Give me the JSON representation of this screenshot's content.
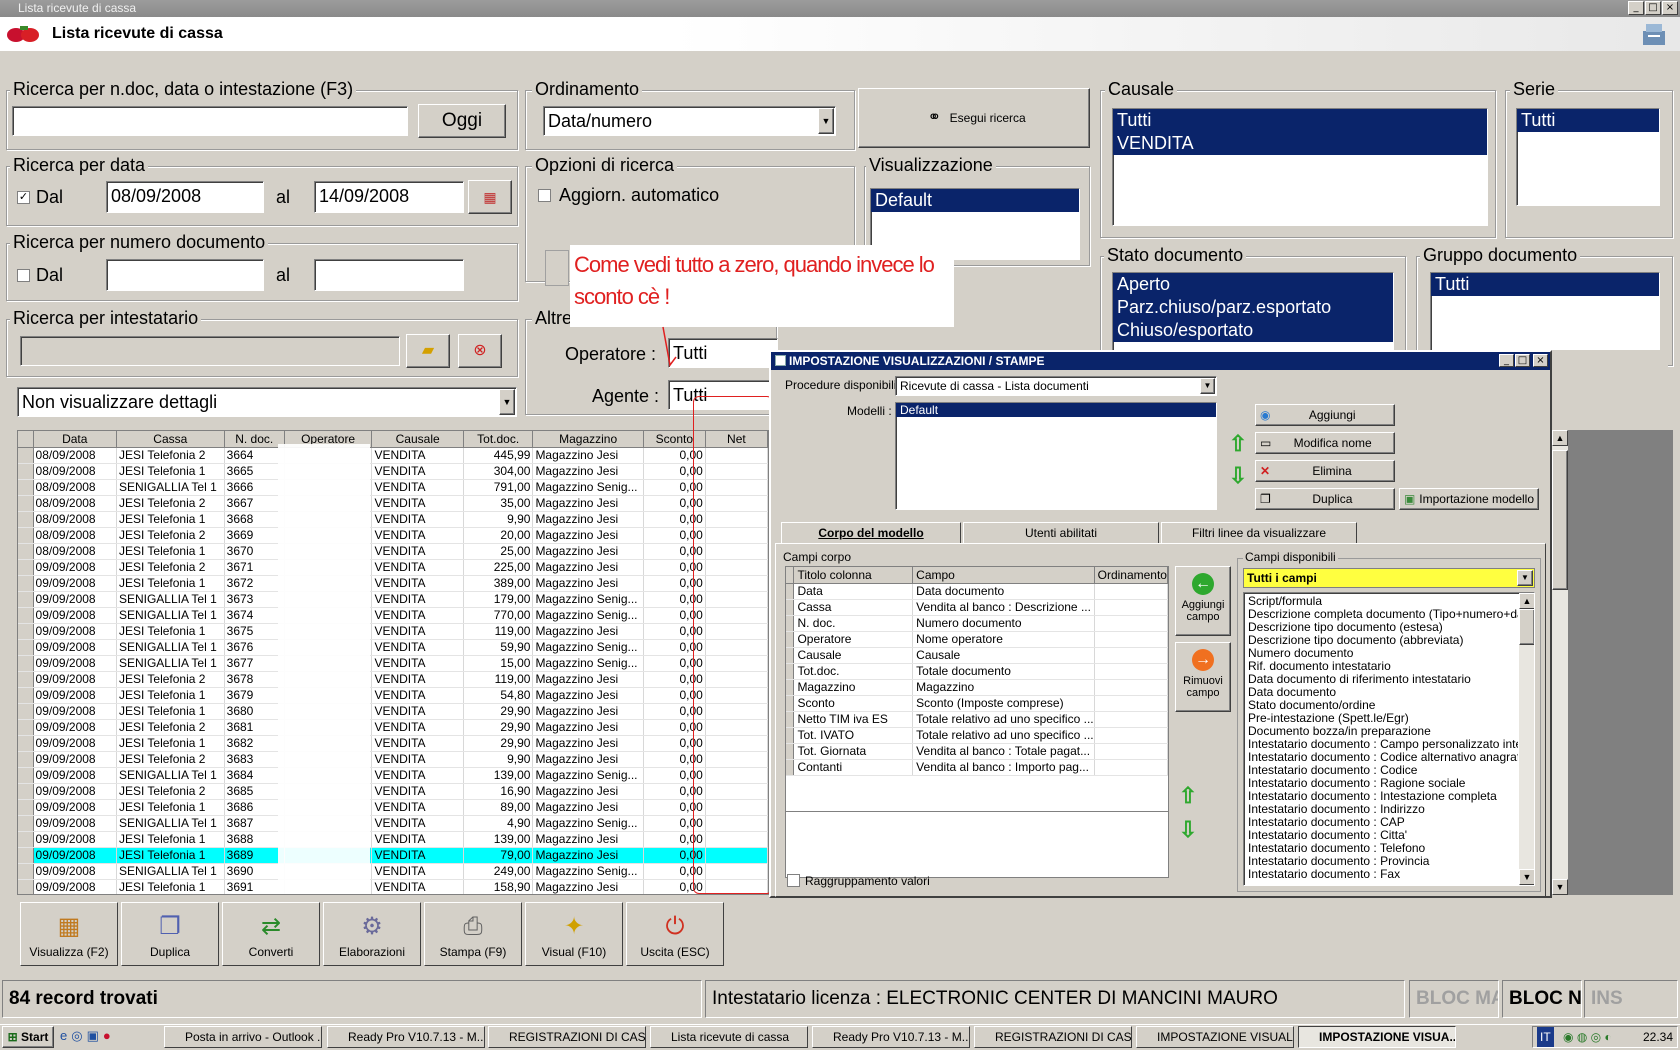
{
  "window": {
    "title": "Lista ricevute di cassa",
    "header_title": "Lista ricevute di cassa"
  },
  "search": {
    "group_label": "Ricerca per n.doc, data o intestazione (F3)",
    "value": "",
    "today_button": "Oggi"
  },
  "ordering": {
    "group_label": "Ordinamento",
    "selected": "Data/numero"
  },
  "execute_button": "Esegui ricerca",
  "causale": {
    "group_label": "Causale",
    "items": [
      "Tutti",
      "VENDITA"
    ]
  },
  "serie": {
    "group_label": "Serie",
    "items": [
      "Tutti"
    ]
  },
  "date_search": {
    "group_label": "Ricerca per data",
    "from_label": "Dal",
    "from_checked": true,
    "from_value": "08/09/2008",
    "to_label": "al",
    "to_value": "14/09/2008"
  },
  "options": {
    "group_label": "Opzioni di ricerca",
    "auto_update_label": "Aggiorn. automatico"
  },
  "view": {
    "group_label": "Visualizzazione",
    "items": [
      "Default"
    ]
  },
  "doc_number_search": {
    "group_label": "Ricerca per numero documento",
    "from_label": "Dal",
    "to_label": "al",
    "from_value": "",
    "to_value": ""
  },
  "doc_state": {
    "group_label": "Stato documento",
    "items": [
      "Aperto",
      "Parz.chiuso/parz.esportato",
      "Chiuso/esportato"
    ]
  },
  "doc_group": {
    "group_label": "Gruppo documento",
    "items": [
      "Tutti"
    ]
  },
  "holder_search": {
    "group_label": "Ricerca per intestatario",
    "value": ""
  },
  "other": {
    "group_label": "Altre",
    "operator_label": "Operatore :",
    "operator_value": "Tutti",
    "agent_label": "Agente :",
    "agent_value": "Tutti"
  },
  "details_select": "Non visualizzare dettagli",
  "annotation": "Come vedi tutto a zero, quando invece lo sconto cè !",
  "grid": {
    "columns": [
      "Data",
      "Cassa",
      "N. doc.",
      "Operatore",
      "Causale",
      "Tot.doc.",
      "Magazzino",
      "Sconto",
      "Net"
    ],
    "rows": [
      [
        "08/09/2008",
        "JESI Telefonia 2",
        "3664",
        "",
        "VENDITA",
        "445,99",
        "Magazzino Jesi",
        "0,00"
      ],
      [
        "08/09/2008",
        "JESI Telefonia 1",
        "3665",
        "",
        "VENDITA",
        "304,00",
        "Magazzino Jesi",
        "0,00"
      ],
      [
        "08/09/2008",
        "SENIGALLIA Tel 1",
        "3666",
        "",
        "VENDITA",
        "791,00",
        "Magazzino Senig...",
        "0,00"
      ],
      [
        "08/09/2008",
        "JESI Telefonia 2",
        "3667",
        "",
        "VENDITA",
        "35,00",
        "Magazzino Jesi",
        "0,00"
      ],
      [
        "08/09/2008",
        "JESI Telefonia 1",
        "3668",
        "",
        "VENDITA",
        "9,90",
        "Magazzino Jesi",
        "0,00"
      ],
      [
        "08/09/2008",
        "JESI Telefonia 2",
        "3669",
        "",
        "VENDITA",
        "20,00",
        "Magazzino Jesi",
        "0,00"
      ],
      [
        "08/09/2008",
        "JESI Telefonia 1",
        "3670",
        "",
        "VENDITA",
        "25,00",
        "Magazzino Jesi",
        "0,00"
      ],
      [
        "09/09/2008",
        "JESI Telefonia 2",
        "3671",
        "",
        "VENDITA",
        "225,00",
        "Magazzino Jesi",
        "0,00"
      ],
      [
        "09/09/2008",
        "JESI Telefonia 1",
        "3672",
        "",
        "VENDITA",
        "389,00",
        "Magazzino Jesi",
        "0,00"
      ],
      [
        "09/09/2008",
        "SENIGALLIA Tel 1",
        "3673",
        "",
        "VENDITA",
        "179,00",
        "Magazzino Senig...",
        "0,00"
      ],
      [
        "09/09/2008",
        "SENIGALLIA Tel 1",
        "3674",
        "",
        "VENDITA",
        "770,00",
        "Magazzino Senig...",
        "0,00"
      ],
      [
        "09/09/2008",
        "JESI Telefonia 1",
        "3675",
        "",
        "VENDITA",
        "119,00",
        "Magazzino Jesi",
        "0,00"
      ],
      [
        "09/09/2008",
        "SENIGALLIA Tel 1",
        "3676",
        "",
        "VENDITA",
        "59,90",
        "Magazzino Senig...",
        "0,00"
      ],
      [
        "09/09/2008",
        "SENIGALLIA Tel 1",
        "3677",
        "",
        "VENDITA",
        "15,00",
        "Magazzino Senig...",
        "0,00"
      ],
      [
        "09/09/2008",
        "JESI Telefonia 2",
        "3678",
        "",
        "VENDITA",
        "119,00",
        "Magazzino Jesi",
        "0,00"
      ],
      [
        "09/09/2008",
        "JESI Telefonia 1",
        "3679",
        "",
        "VENDITA",
        "54,80",
        "Magazzino Jesi",
        "0,00"
      ],
      [
        "09/09/2008",
        "JESI Telefonia 1",
        "3680",
        "",
        "VENDITA",
        "29,90",
        "Magazzino Jesi",
        "0,00"
      ],
      [
        "09/09/2008",
        "JESI Telefonia 2",
        "3681",
        "",
        "VENDITA",
        "29,90",
        "Magazzino Jesi",
        "0,00"
      ],
      [
        "09/09/2008",
        "JESI Telefonia 1",
        "3682",
        "",
        "VENDITA",
        "29,90",
        "Magazzino Jesi",
        "0,00"
      ],
      [
        "09/09/2008",
        "JESI Telefonia 2",
        "3683",
        "",
        "VENDITA",
        "9,90",
        "Magazzino Jesi",
        "0,00"
      ],
      [
        "09/09/2008",
        "SENIGALLIA Tel 1",
        "3684",
        "",
        "VENDITA",
        "139,00",
        "Magazzino Senig...",
        "0,00"
      ],
      [
        "09/09/2008",
        "JESI Telefonia 2",
        "3685",
        "",
        "VENDITA",
        "16,90",
        "Magazzino Jesi",
        "0,00"
      ],
      [
        "09/09/2008",
        "JESI Telefonia 1",
        "3686",
        "",
        "VENDITA",
        "89,00",
        "Magazzino Jesi",
        "0,00"
      ],
      [
        "09/09/2008",
        "SENIGALLIA Tel 1",
        "3687",
        "",
        "VENDITA",
        "4,90",
        "Magazzino Senig...",
        "0,00"
      ],
      [
        "09/09/2008",
        "JESI Telefonia 1",
        "3688",
        "",
        "VENDITA",
        "139,00",
        "Magazzino Jesi",
        "0,00"
      ],
      [
        "09/09/2008",
        "JESI Telefonia 1",
        "3689",
        "",
        "VENDITA",
        "79,00",
        "Magazzino Jesi",
        "0,00"
      ],
      [
        "09/09/2008",
        "SENIGALLIA Tel 1",
        "3690",
        "",
        "VENDITA",
        "249,00",
        "Magazzino Senig...",
        "0,00"
      ],
      [
        "09/09/2008",
        "JESI Telefonia 1",
        "3691",
        "",
        "VENDITA",
        "158,90",
        "Magazzino Jesi",
        "0,00"
      ]
    ],
    "highlighted_row": 25
  },
  "toolbar": [
    {
      "label": "Visualizza (F2)",
      "icon": "view-icon"
    },
    {
      "label": "Duplica",
      "icon": "duplicate-icon"
    },
    {
      "label": "Converti",
      "icon": "convert-icon"
    },
    {
      "label": "Elaborazioni",
      "icon": "process-icon"
    },
    {
      "label": "Stampa (F9)",
      "icon": "print-icon"
    },
    {
      "label": "Visual (F10)",
      "icon": "wand-icon"
    },
    {
      "label": "Uscita (ESC)",
      "icon": "exit-icon"
    }
  ],
  "status": {
    "records": "84 record trovati",
    "license": "Intestatario licenza : ELECTRONIC CENTER DI MANCINI MAURO",
    "caps": "BLOC MA",
    "num": "BLOC N",
    "ins": "INS"
  },
  "dialog": {
    "title": "IMPOSTAZIONE VISUALIZZAZIONI / STAMPE",
    "procedures_label": "Procedure disponibili :",
    "procedures_value": "Ricevute di cassa - Lista documenti",
    "models_label": "Modelli :",
    "models": [
      "Default"
    ],
    "buttons": {
      "add": "Aggiungi",
      "rename": "Modifica nome",
      "delete": "Elimina",
      "duplicate": "Duplica",
      "import": "Importazione modello"
    },
    "tabs": [
      "Corpo del modello",
      "Utenti abilitati",
      "Filtri linee da visualizzare"
    ],
    "body_fields_label": "Campi corpo",
    "body_columns": [
      "Titolo colonna",
      "Campo",
      "Ordinamento"
    ],
    "body_rows": [
      [
        "Data",
        "Data documento",
        ""
      ],
      [
        "Cassa",
        "Vendita al banco : Descrizione ...",
        ""
      ],
      [
        "N. doc.",
        "Numero documento",
        ""
      ],
      [
        "Operatore",
        "Nome operatore",
        ""
      ],
      [
        "Causale",
        "Causale",
        ""
      ],
      [
        "Tot.doc.",
        "Totale documento",
        ""
      ],
      [
        "Magazzino",
        "Magazzino",
        ""
      ],
      [
        "Sconto",
        "Sconto (Imposte comprese)",
        ""
      ],
      [
        "Netto TIM iva ES",
        "Totale relativo ad uno specifico ...",
        ""
      ],
      [
        "Tot. IVATO",
        "Totale relativo ad uno specifico ...",
        ""
      ],
      [
        "Tot. Giornata",
        "Vendita al banco : Totale pagat...",
        ""
      ],
      [
        "Contanti",
        "Vendita al banco : Importo pag...",
        ""
      ]
    ],
    "add_field": "Aggiungi campo",
    "remove_field": "Rimuovi campo",
    "group_values_label": "Raggruppamento valori",
    "available_label": "Campi disponibili",
    "available_filter": "Tutti i campi",
    "available_fields": [
      "Script/formula",
      "Descrizione completa documento (Tipo+numero+data)",
      "Descrizione tipo documento (estesa)",
      "Descrizione tipo documento (abbreviata)",
      "Numero documento",
      "Rif. documento intestatario",
      "Data documento di riferimento intestatario",
      "Data documento",
      "Stato documento/ordine",
      "Pre-intestazione (Spett.le/Egr)",
      "Documento bozza/in preparazione",
      "Intestatario documento : Campo personalizzato intestatario",
      "Intestatario documento : Codice alternativo anagrafica",
      "Intestatario documento : Codice",
      "Intestatario documento : Ragione sociale",
      "Intestatario documento : Intestazione completa",
      "Intestatario documento : Indirizzo",
      "Intestatario documento : CAP",
      "Intestatario documento : Citta'",
      "Intestatario documento : Telefono",
      "Intestatario documento : Provincia",
      "Intestatario documento : Fax"
    ]
  },
  "taskbar": {
    "start": "Start",
    "tasks": [
      "Posta in arrivo - Outlook ...",
      "Ready Pro V10.7.13 - M...",
      "REGISTRAZIONI DI CASSA",
      "Lista ricevute di cassa",
      "Ready Pro V10.7.13 - M...",
      "REGISTRAZIONI DI CASSA",
      "IMPOSTAZIONE VISUALI...",
      "IMPOSTAZIONE VISUA..."
    ],
    "active_task": 7,
    "lang": "IT",
    "clock": "22.34"
  }
}
